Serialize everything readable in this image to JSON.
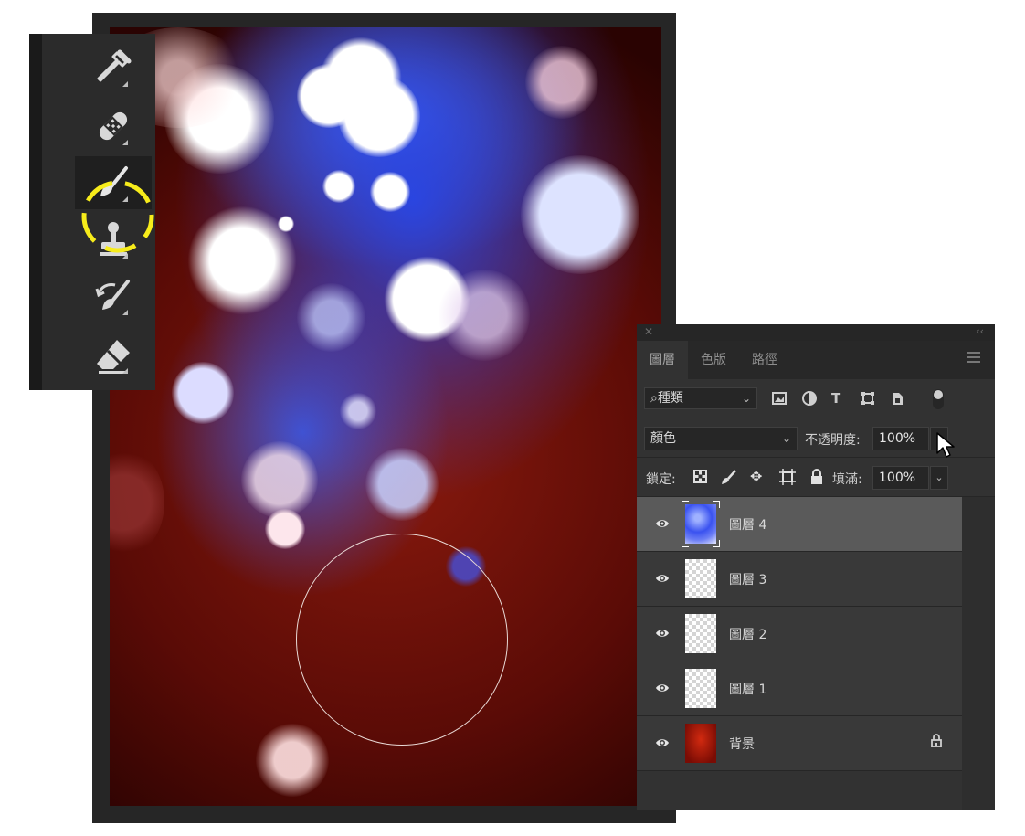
{
  "toolbar": {
    "tools": [
      {
        "name": "eyedropper-tool",
        "icon": "eyedropper-icon"
      },
      {
        "name": "healing-brush-tool",
        "icon": "bandage-icon"
      },
      {
        "name": "brush-tool",
        "icon": "brush-icon",
        "active": true
      },
      {
        "name": "clone-stamp-tool",
        "icon": "stamp-icon"
      },
      {
        "name": "history-brush-tool",
        "icon": "history-brush-icon"
      },
      {
        "name": "eraser-tool",
        "icon": "eraser-icon"
      }
    ],
    "highlight_color": "#f7ec1b"
  },
  "layers_panel": {
    "tabs": [
      "圖層",
      "色版",
      "路徑"
    ],
    "filter": {
      "kind_label": "種類"
    },
    "blend_mode": "顏色",
    "opacity_label": "不透明度:",
    "opacity_value": "100%",
    "lock_label": "鎖定:",
    "fill_label": "填滿:",
    "fill_value": "100%",
    "layers": [
      {
        "name": "圖層 4",
        "thumb": "blue",
        "selected": true
      },
      {
        "name": "圖層 3",
        "thumb": "transparent"
      },
      {
        "name": "圖層 2",
        "thumb": "transparent"
      },
      {
        "name": "圖層 1",
        "thumb": "transparent"
      },
      {
        "name": "背景",
        "thumb": "background",
        "locked": true
      }
    ]
  },
  "colors": {
    "panel_bg": "#323232",
    "selected_layer": "#5a5a5a",
    "canvas_red": "#8a1a0e",
    "canvas_blue": "#3a52f0"
  }
}
